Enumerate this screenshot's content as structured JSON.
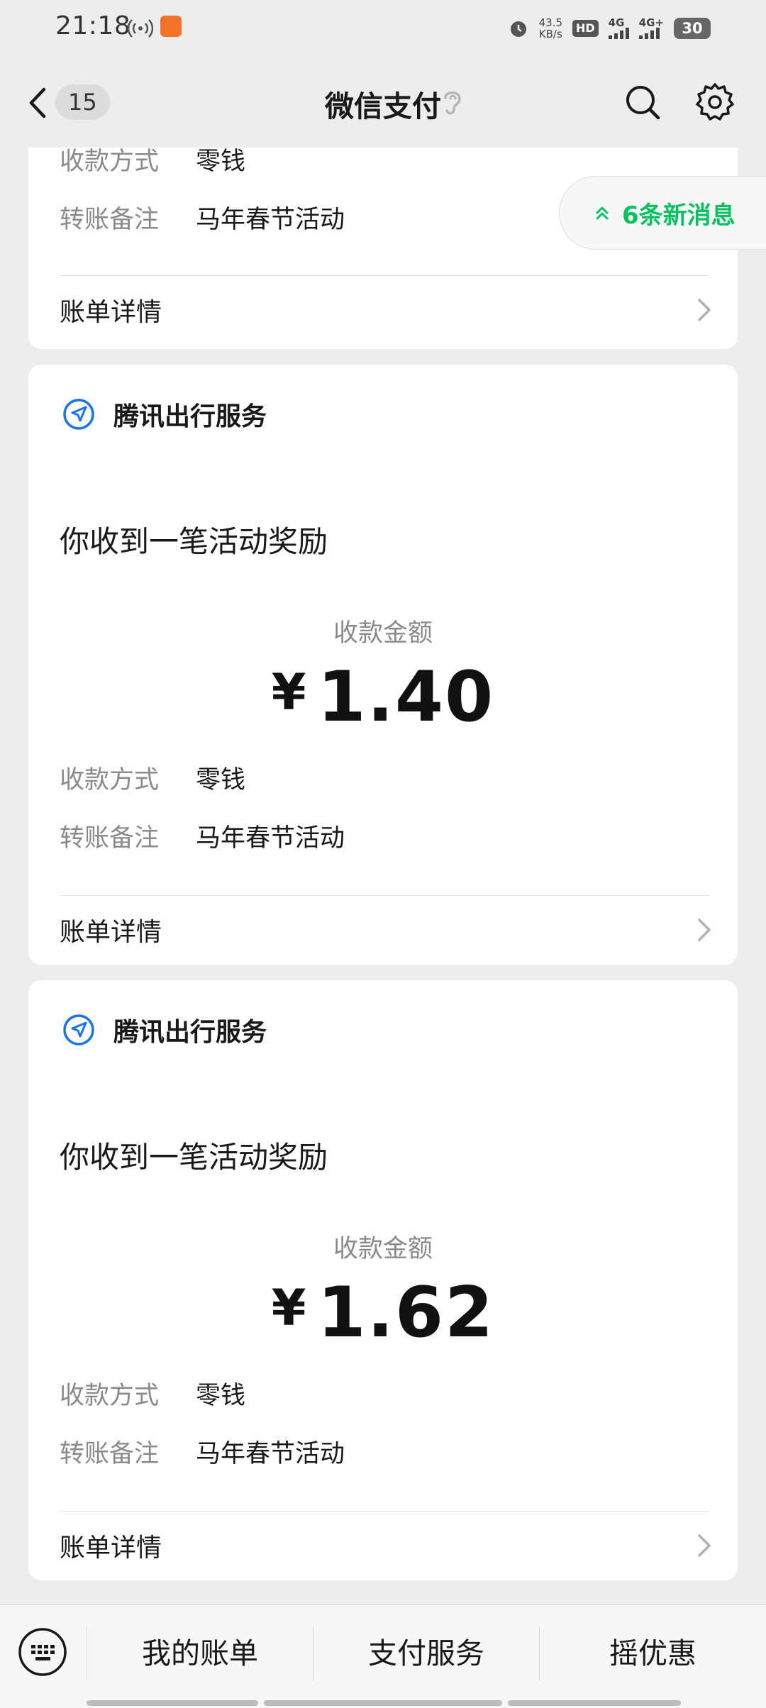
{
  "status_bar": {
    "time": "21:18",
    "net_speed_value": "43.5",
    "net_speed_unit": "KB/s",
    "hd_label": "HD",
    "signal1_label": "4G",
    "signal2_label": "4G+",
    "battery": "30"
  },
  "nav": {
    "unread_count": "15",
    "title": "微信支付"
  },
  "new_messages": "6条新消息",
  "partial_card": {
    "method_label": "收款方式",
    "method_value": "零钱",
    "note_label": "转账备注",
    "note_value": "马年春节活动",
    "detail_label": "账单详情"
  },
  "cards": [
    {
      "service": "腾讯出行服务",
      "title": "你收到一笔活动奖励",
      "amount_label": "收款金额",
      "currency": "¥",
      "amount": "1.40",
      "method_label": "收款方式",
      "method_value": "零钱",
      "note_label": "转账备注",
      "note_value": "马年春节活动",
      "detail_label": "账单详情"
    },
    {
      "service": "腾讯出行服务",
      "title": "你收到一笔活动奖励",
      "amount_label": "收款金额",
      "currency": "¥",
      "amount": "1.62",
      "method_label": "收款方式",
      "method_value": "零钱",
      "note_label": "转账备注",
      "note_value": "马年春节活动",
      "detail_label": "账单详情"
    }
  ],
  "bottom_menu": {
    "items": [
      "我的账单",
      "支付服务",
      "摇优惠"
    ]
  },
  "colors": {
    "accent": "#07c160",
    "service_icon": "#1a73e8",
    "background": "#ededed"
  }
}
